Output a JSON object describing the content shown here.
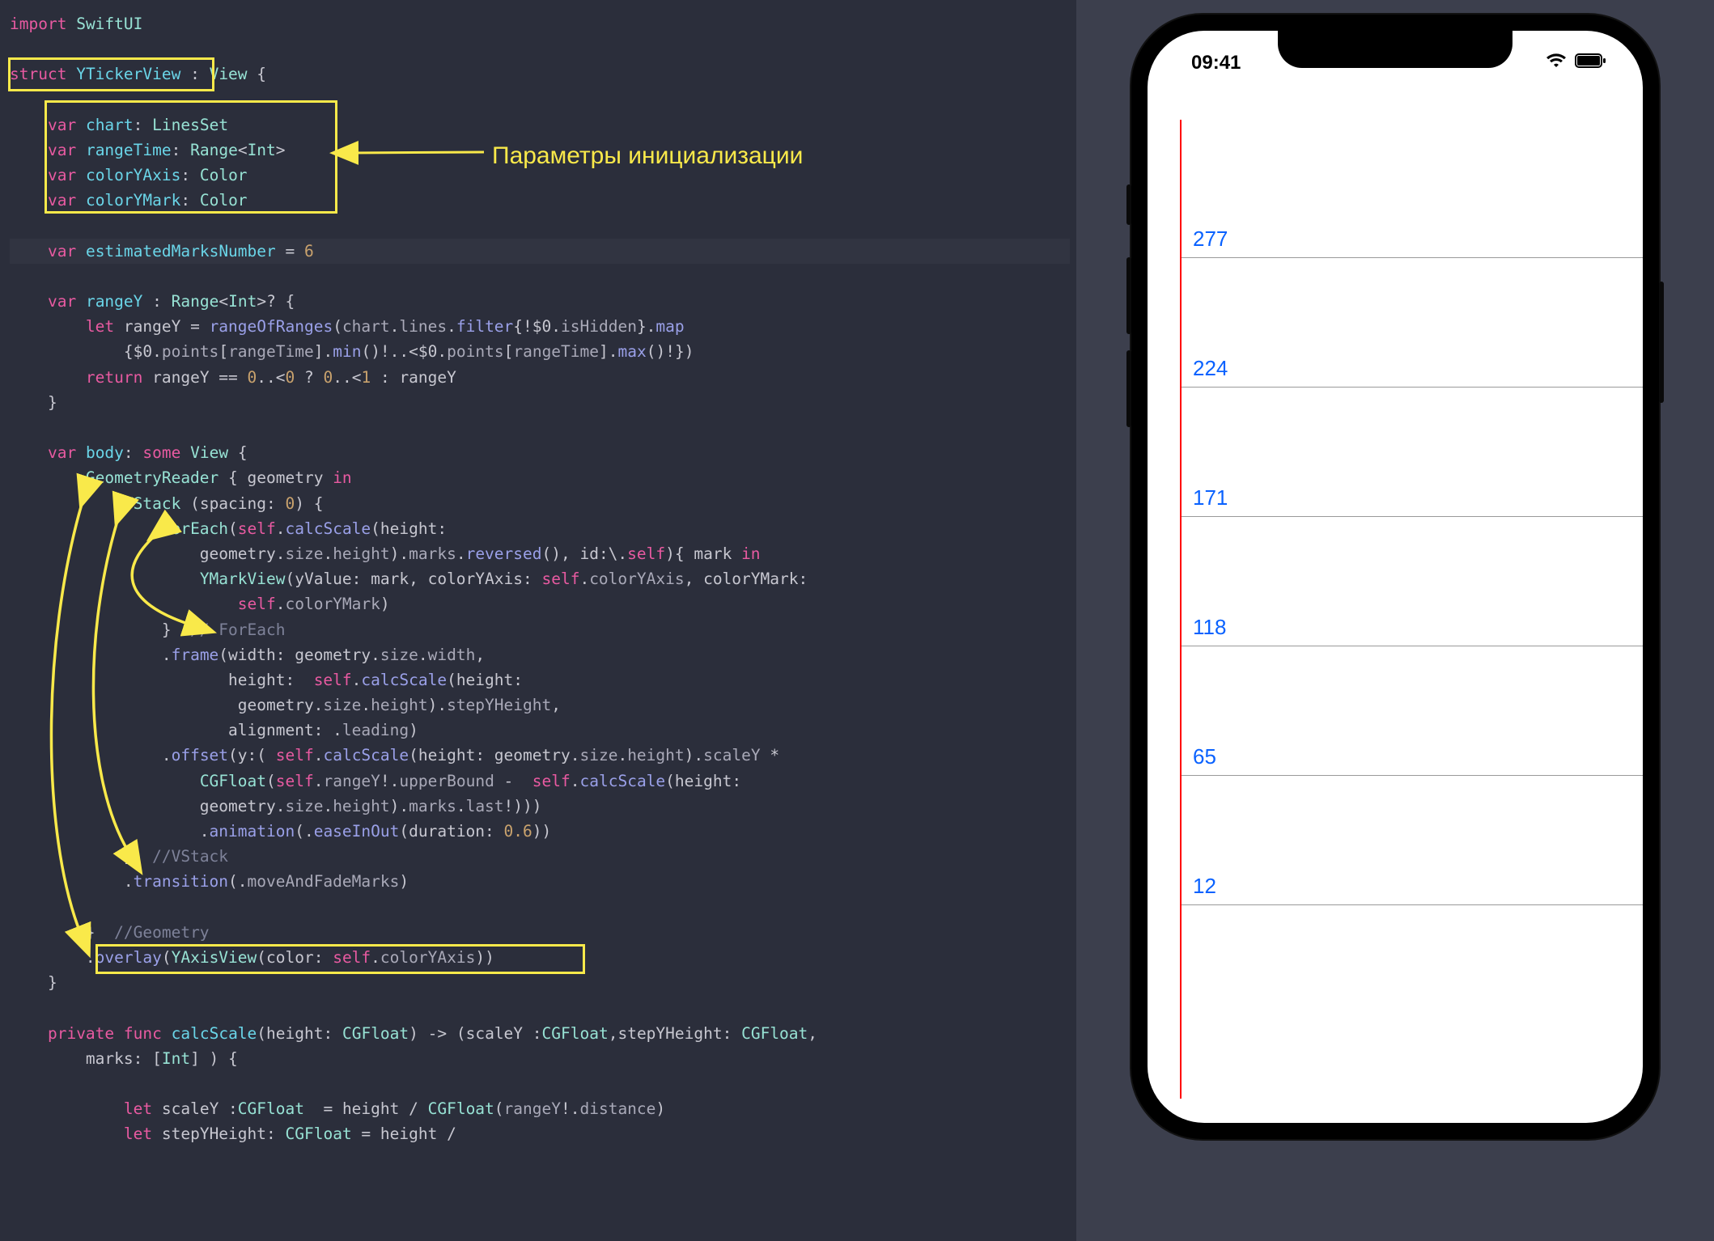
{
  "annotation": {
    "init_params_label": "Параметры инициализации"
  },
  "code": {
    "lines": [
      [
        [
          "kw",
          "import"
        ],
        [
          "punct",
          " "
        ],
        [
          "type",
          "SwiftUI"
        ]
      ],
      [],
      [
        [
          "kw",
          "struct"
        ],
        [
          "punct",
          " "
        ],
        [
          "type-def",
          "YTickerView"
        ],
        [
          "punct",
          " : "
        ],
        [
          "type",
          "View"
        ],
        [
          "punct",
          " {"
        ]
      ],
      [],
      [
        [
          "punct",
          "    "
        ],
        [
          "kw",
          "var"
        ],
        [
          "punct",
          " "
        ],
        [
          "prop",
          "chart"
        ],
        [
          "punct",
          ": "
        ],
        [
          "type",
          "LinesSet"
        ]
      ],
      [
        [
          "punct",
          "    "
        ],
        [
          "kw",
          "var"
        ],
        [
          "punct",
          " "
        ],
        [
          "prop",
          "rangeTime"
        ],
        [
          "punct",
          ": "
        ],
        [
          "type",
          "Range"
        ],
        [
          "punct",
          "<"
        ],
        [
          "type",
          "Int"
        ],
        [
          "punct",
          ">"
        ]
      ],
      [
        [
          "punct",
          "    "
        ],
        [
          "kw",
          "var"
        ],
        [
          "punct",
          " "
        ],
        [
          "prop",
          "colorYAxis"
        ],
        [
          "punct",
          ": "
        ],
        [
          "type",
          "Color"
        ]
      ],
      [
        [
          "punct",
          "    "
        ],
        [
          "kw",
          "var"
        ],
        [
          "punct",
          " "
        ],
        [
          "prop",
          "colorYMark"
        ],
        [
          "punct",
          ": "
        ],
        [
          "type",
          "Color"
        ]
      ],
      [],
      [
        [
          "punct",
          "    "
        ],
        [
          "kw",
          "var"
        ],
        [
          "punct",
          " "
        ],
        [
          "prop",
          "estimatedMarksNumber"
        ],
        [
          "punct",
          " = "
        ],
        [
          "num",
          "6"
        ]
      ],
      [],
      [
        [
          "punct",
          "    "
        ],
        [
          "kw",
          "var"
        ],
        [
          "punct",
          " "
        ],
        [
          "prop",
          "rangeY"
        ],
        [
          "punct",
          " : "
        ],
        [
          "type",
          "Range"
        ],
        [
          "punct",
          "<"
        ],
        [
          "type",
          "Int"
        ],
        [
          "punct",
          ">? {"
        ]
      ],
      [
        [
          "punct",
          "        "
        ],
        [
          "kw",
          "let"
        ],
        [
          "punct",
          " rangeY = "
        ],
        [
          "func",
          "rangeOfRanges"
        ],
        [
          "punct",
          "("
        ],
        [
          "member",
          "chart"
        ],
        [
          "punct",
          "."
        ],
        [
          "member",
          "lines"
        ],
        [
          "punct",
          "."
        ],
        [
          "func",
          "filter"
        ],
        [
          "punct",
          "{!"
        ],
        [
          "ident",
          "$0"
        ],
        [
          "punct",
          "."
        ],
        [
          "member",
          "isHidden"
        ],
        [
          "punct",
          "}."
        ],
        [
          "func",
          "map"
        ]
      ],
      [
        [
          "punct",
          "            {"
        ],
        [
          "ident",
          "$0"
        ],
        [
          "punct",
          "."
        ],
        [
          "member",
          "points"
        ],
        [
          "punct",
          "["
        ],
        [
          "member",
          "rangeTime"
        ],
        [
          "punct",
          "]."
        ],
        [
          "func",
          "min"
        ],
        [
          "punct",
          "()!..<"
        ],
        [
          "ident",
          "$0"
        ],
        [
          "punct",
          "."
        ],
        [
          "member",
          "points"
        ],
        [
          "punct",
          "["
        ],
        [
          "member",
          "rangeTime"
        ],
        [
          "punct",
          "]."
        ],
        [
          "func",
          "max"
        ],
        [
          "punct",
          "()!})"
        ]
      ],
      [
        [
          "punct",
          "        "
        ],
        [
          "kw",
          "return"
        ],
        [
          "punct",
          " rangeY == "
        ],
        [
          "num",
          "0"
        ],
        [
          "punct",
          "..<"
        ],
        [
          "num",
          "0"
        ],
        [
          "punct",
          " ? "
        ],
        [
          "num",
          "0"
        ],
        [
          "punct",
          "..<"
        ],
        [
          "num",
          "1"
        ],
        [
          "punct",
          " : rangeY"
        ]
      ],
      [
        [
          "punct",
          "    }"
        ]
      ],
      [],
      [
        [
          "punct",
          "    "
        ],
        [
          "kw",
          "var"
        ],
        [
          "punct",
          " "
        ],
        [
          "prop",
          "body"
        ],
        [
          "punct",
          ": "
        ],
        [
          "kw",
          "some"
        ],
        [
          "punct",
          " "
        ],
        [
          "type",
          "View"
        ],
        [
          "punct",
          " {"
        ]
      ],
      [
        [
          "punct",
          "        "
        ],
        [
          "type",
          "GeometryReader"
        ],
        [
          "punct",
          " { geometry "
        ],
        [
          "in",
          "in"
        ]
      ],
      [
        [
          "punct",
          "            "
        ],
        [
          "type",
          "VStack"
        ],
        [
          "punct",
          " (spacing: "
        ],
        [
          "num",
          "0"
        ],
        [
          "punct",
          ") {"
        ]
      ],
      [
        [
          "punct",
          "                "
        ],
        [
          "type",
          "ForEach"
        ],
        [
          "punct",
          "("
        ],
        [
          "self",
          "self"
        ],
        [
          "punct",
          "."
        ],
        [
          "func",
          "calcScale"
        ],
        [
          "punct",
          "(height:"
        ]
      ],
      [
        [
          "punct",
          "                    geometry."
        ],
        [
          "member",
          "size"
        ],
        [
          "punct",
          "."
        ],
        [
          "member",
          "height"
        ],
        [
          "punct",
          ")."
        ],
        [
          "member",
          "marks"
        ],
        [
          "punct",
          "."
        ],
        [
          "func",
          "reversed"
        ],
        [
          "punct",
          "(), id:\\."
        ],
        [
          "self",
          "self"
        ],
        [
          "punct",
          "){ mark "
        ],
        [
          "in",
          "in"
        ]
      ],
      [
        [
          "punct",
          "                    "
        ],
        [
          "type",
          "YMarkView"
        ],
        [
          "punct",
          "(yValue: mark, colorYAxis: "
        ],
        [
          "self",
          "self"
        ],
        [
          "punct",
          "."
        ],
        [
          "member",
          "colorYAxis"
        ],
        [
          "punct",
          ", colorYMark:"
        ]
      ],
      [
        [
          "punct",
          "                        "
        ],
        [
          "self",
          "self"
        ],
        [
          "punct",
          "."
        ],
        [
          "member",
          "colorYMark"
        ],
        [
          "punct",
          ")"
        ]
      ],
      [
        [
          "punct",
          "                } "
        ],
        [
          "comment",
          " // ForEach"
        ]
      ],
      [
        [
          "punct",
          "                ."
        ],
        [
          "func",
          "frame"
        ],
        [
          "punct",
          "(width: geometry."
        ],
        [
          "member",
          "size"
        ],
        [
          "punct",
          "."
        ],
        [
          "member",
          "width"
        ],
        [
          "punct",
          ","
        ]
      ],
      [
        [
          "punct",
          "                       height:  "
        ],
        [
          "self",
          "self"
        ],
        [
          "punct",
          "."
        ],
        [
          "func",
          "calcScale"
        ],
        [
          "punct",
          "(height:"
        ]
      ],
      [
        [
          "punct",
          "                        geometry."
        ],
        [
          "member",
          "size"
        ],
        [
          "punct",
          "."
        ],
        [
          "member",
          "height"
        ],
        [
          "punct",
          ")."
        ],
        [
          "member",
          "stepYHeight"
        ],
        [
          "punct",
          ","
        ]
      ],
      [
        [
          "punct",
          "                       alignment: ."
        ],
        [
          "member",
          "leading"
        ],
        [
          "punct",
          ")"
        ]
      ],
      [
        [
          "punct",
          "                ."
        ],
        [
          "func",
          "offset"
        ],
        [
          "punct",
          "(y:( "
        ],
        [
          "self",
          "self"
        ],
        [
          "punct",
          "."
        ],
        [
          "func",
          "calcScale"
        ],
        [
          "punct",
          "(height: geometry."
        ],
        [
          "member",
          "size"
        ],
        [
          "punct",
          "."
        ],
        [
          "member",
          "height"
        ],
        [
          "punct",
          ")."
        ],
        [
          "member",
          "scaleY"
        ],
        [
          "punct",
          " *"
        ]
      ],
      [
        [
          "punct",
          "                    "
        ],
        [
          "type",
          "CGFloat"
        ],
        [
          "punct",
          "("
        ],
        [
          "self",
          "self"
        ],
        [
          "punct",
          "."
        ],
        [
          "member",
          "rangeY"
        ],
        [
          "punct",
          "!."
        ],
        [
          "member",
          "upperBound"
        ],
        [
          "punct",
          " -  "
        ],
        [
          "self",
          "self"
        ],
        [
          "punct",
          "."
        ],
        [
          "func",
          "calcScale"
        ],
        [
          "punct",
          "(height:"
        ]
      ],
      [
        [
          "punct",
          "                    geometry."
        ],
        [
          "member",
          "size"
        ],
        [
          "punct",
          "."
        ],
        [
          "member",
          "height"
        ],
        [
          "punct",
          ")."
        ],
        [
          "member",
          "marks"
        ],
        [
          "punct",
          "."
        ],
        [
          "member",
          "last"
        ],
        [
          "punct",
          "!)))"
        ]
      ],
      [
        [
          "punct",
          "                    ."
        ],
        [
          "func",
          "animation"
        ],
        [
          "punct",
          "(."
        ],
        [
          "func",
          "easeInOut"
        ],
        [
          "punct",
          "(duration: "
        ],
        [
          "num",
          "0.6"
        ],
        [
          "punct",
          "))"
        ]
      ],
      [
        [
          "punct",
          "            } "
        ],
        [
          "comment",
          " //VStack"
        ]
      ],
      [
        [
          "punct",
          "            ."
        ],
        [
          "func",
          "transition"
        ],
        [
          "punct",
          "(."
        ],
        [
          "member",
          "moveAndFadeMarks"
        ],
        [
          "punct",
          ")"
        ]
      ],
      [],
      [
        [
          "punct",
          "        } "
        ],
        [
          "comment",
          " //Geometry"
        ]
      ],
      [
        [
          "punct",
          "        ."
        ],
        [
          "func",
          "overlay"
        ],
        [
          "punct",
          "("
        ],
        [
          "type",
          "YAxisView"
        ],
        [
          "punct",
          "(color: "
        ],
        [
          "self",
          "self"
        ],
        [
          "punct",
          "."
        ],
        [
          "member",
          "colorYAxis"
        ],
        [
          "punct",
          "))"
        ]
      ],
      [
        [
          "punct",
          "    }"
        ]
      ],
      [],
      [
        [
          "punct",
          "    "
        ],
        [
          "kw",
          "private"
        ],
        [
          "punct",
          " "
        ],
        [
          "kw",
          "func"
        ],
        [
          "punct",
          " "
        ],
        [
          "type-def",
          "calcScale"
        ],
        [
          "punct",
          "(height: "
        ],
        [
          "type",
          "CGFloat"
        ],
        [
          "punct",
          ") -> (scaleY :"
        ],
        [
          "type",
          "CGFloat"
        ],
        [
          "punct",
          ",stepYHeight: "
        ],
        [
          "type",
          "CGFloat"
        ],
        [
          "punct",
          ","
        ]
      ],
      [
        [
          "punct",
          "        marks: ["
        ],
        [
          "type",
          "Int"
        ],
        [
          "punct",
          "] ) {"
        ]
      ],
      [],
      [
        [
          "punct",
          "            "
        ],
        [
          "kw",
          "let"
        ],
        [
          "punct",
          " scaleY :"
        ],
        [
          "type",
          "CGFloat"
        ],
        [
          "punct",
          "  = height / "
        ],
        [
          "type",
          "CGFloat"
        ],
        [
          "punct",
          "("
        ],
        [
          "member",
          "rangeY"
        ],
        [
          "punct",
          "!."
        ],
        [
          "member",
          "distance"
        ],
        [
          "punct",
          ")"
        ]
      ],
      [
        [
          "punct",
          "            "
        ],
        [
          "kw",
          "let"
        ],
        [
          "punct",
          " stepYHeight: "
        ],
        [
          "type",
          "CGFloat"
        ],
        [
          "punct",
          " = height /"
        ]
      ]
    ]
  },
  "preview": {
    "status_time": "09:41",
    "y_marks": [
      "277",
      "224",
      "171",
      "118",
      "65",
      "12"
    ]
  }
}
